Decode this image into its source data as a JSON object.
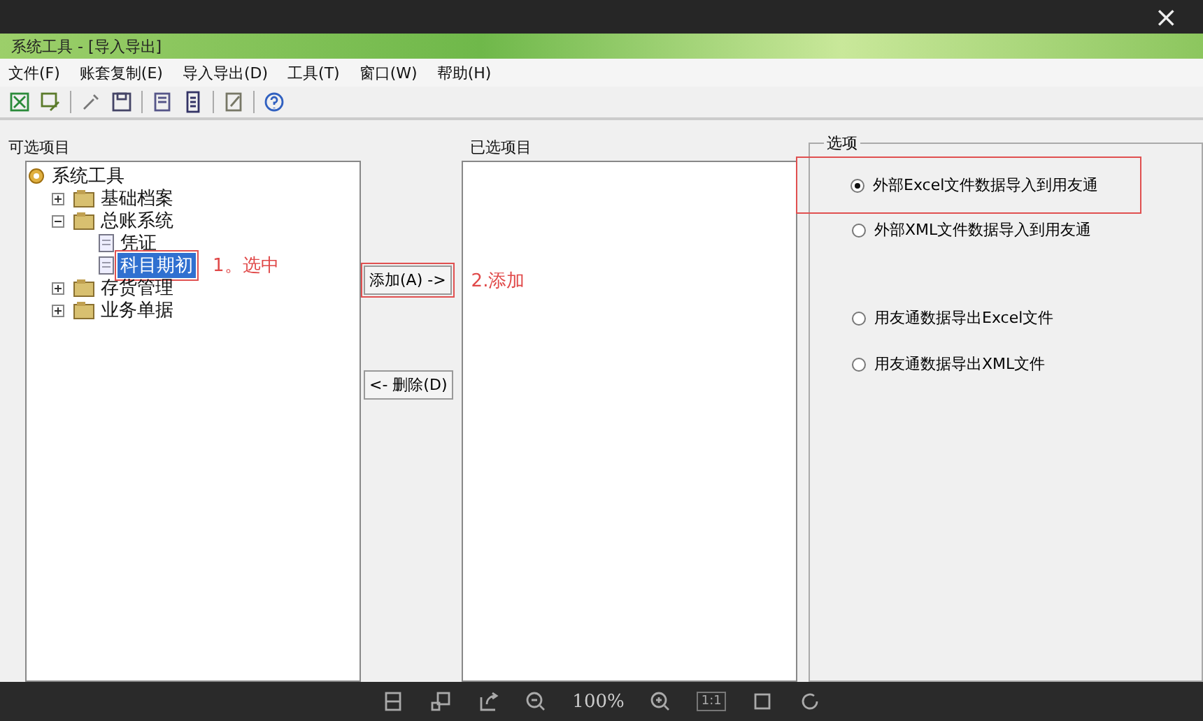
{
  "viewer_top": {
    "close": "×"
  },
  "window": {
    "title": "系统工具 - [导入导出]"
  },
  "menu": [
    {
      "label": "文件(F)"
    },
    {
      "label": "账套复制(E)"
    },
    {
      "label": "导入导出(D)"
    },
    {
      "label": "工具(T)"
    },
    {
      "label": "窗口(W)"
    },
    {
      "label": "帮助(H)"
    }
  ],
  "left_panel": {
    "label": "可选项目",
    "tree": [
      {
        "label": "系统工具",
        "kind": "root",
        "selected": false,
        "highlighted": false,
        "children": [
          {
            "label": "基础档案",
            "kind": "folder",
            "expanded": false,
            "selected": false,
            "highlighted": false
          },
          {
            "label": "总账系统",
            "kind": "folder",
            "expanded": true,
            "selected": false,
            "highlighted": false,
            "children": [
              {
                "label": "凭证",
                "kind": "document",
                "selected": false,
                "highlighted": false
              },
              {
                "label": "科目期初",
                "kind": "document",
                "selected": true,
                "highlighted": true,
                "note": "1。选中"
              }
            ]
          },
          {
            "label": "存货管理",
            "kind": "folder",
            "expanded": false,
            "selected": false,
            "highlighted": false
          },
          {
            "label": "业务单据",
            "kind": "folder",
            "expanded": false,
            "selected": false,
            "highlighted": false
          }
        ]
      }
    ]
  },
  "buttons": [
    {
      "label": "添加(A) ->",
      "highlighted": true,
      "note": "2.添加"
    },
    {
      "label": "<- 删除(D)",
      "highlighted": false
    }
  ],
  "right_list": {
    "label": "已选项目"
  },
  "options": {
    "label": "选项",
    "radios": [
      {
        "label": "外部Excel文件数据导入到用友通",
        "selected": true,
        "highlighted": true
      },
      {
        "label": "外部XML文件数据导入到用友通",
        "selected": false,
        "highlighted": false
      },
      {
        "label": "用友通数据导出Excel文件",
        "selected": false,
        "highlighted": false
      },
      {
        "label": "用友通数据导出XML文件",
        "selected": false,
        "highlighted": false
      }
    ]
  },
  "viewer_bottom": {
    "zoom": "100%",
    "actual_size": "1:1"
  }
}
